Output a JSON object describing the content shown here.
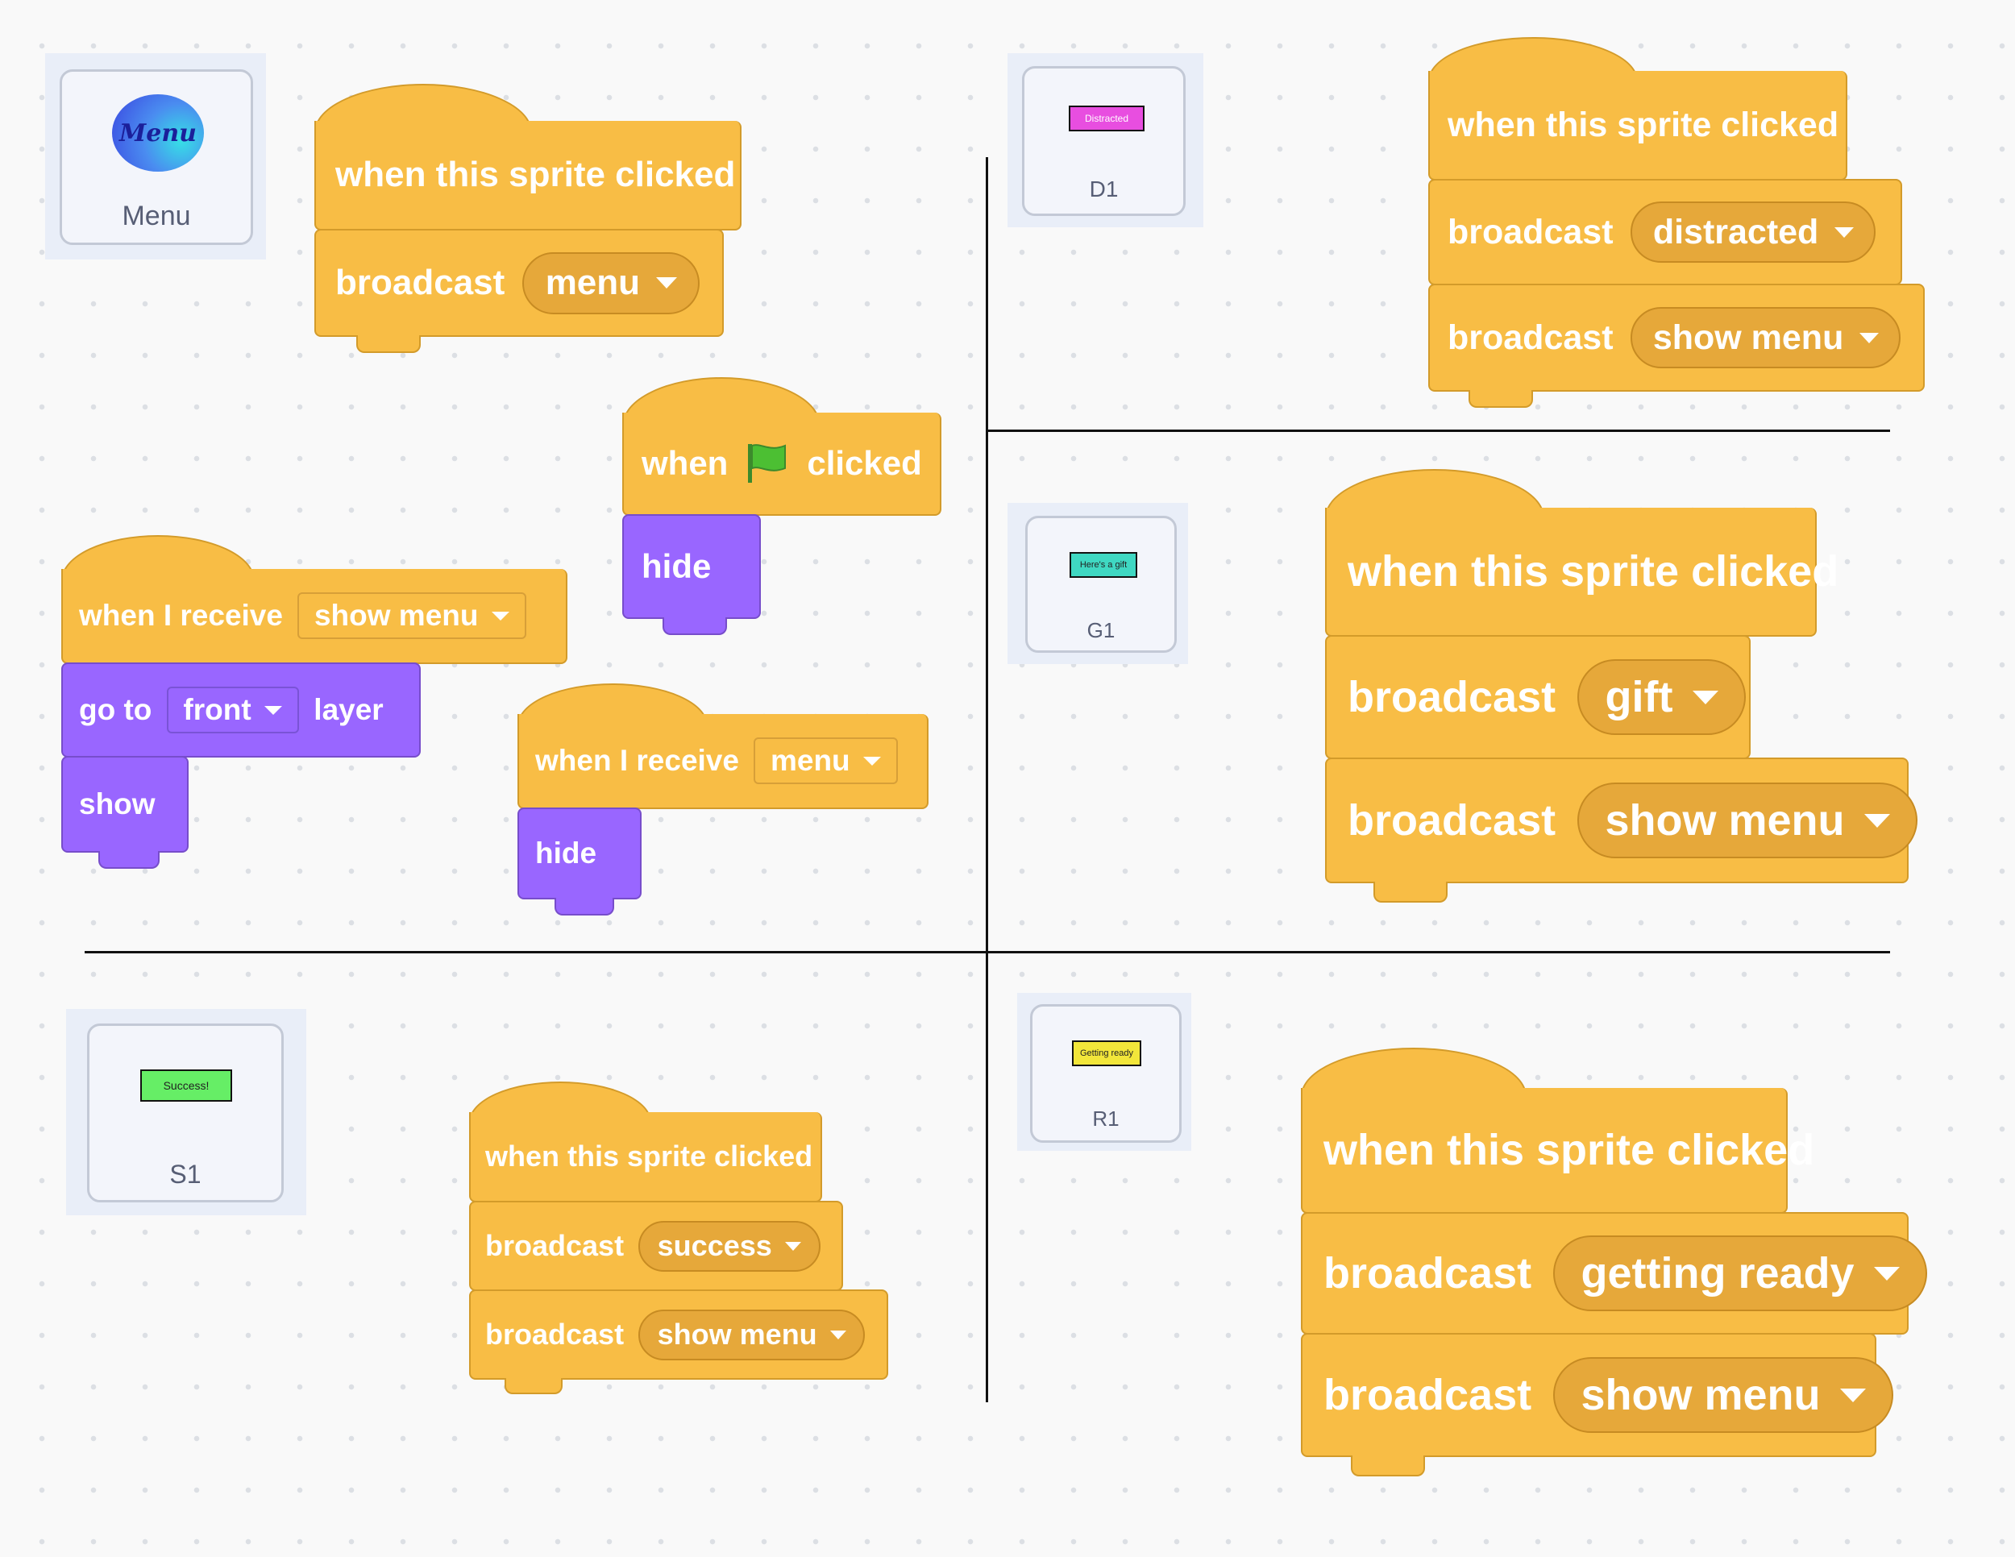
{
  "sprites": {
    "menu": {
      "name": "Menu",
      "costume_text": "Menu"
    },
    "d1": {
      "name": "D1",
      "costume_text": "Distracted",
      "color": "#e84ee0"
    },
    "g1": {
      "name": "G1",
      "costume_text": "Here's a gift",
      "color": "#3fd8c2"
    },
    "s1": {
      "name": "S1",
      "costume_text": "Success!",
      "color": "#66ee66"
    },
    "r1": {
      "name": "R1",
      "costume_text": "Getting ready",
      "color": "#f2e63a"
    }
  },
  "scripts": {
    "menu_click": {
      "hat": "when this sprite clicked",
      "broadcast": "broadcast",
      "message": "menu"
    },
    "flag": {
      "when": "when",
      "clicked": "clicked",
      "hide": "hide"
    },
    "show_menu_receive": {
      "hat": "when I receive",
      "message": "show menu",
      "goto": "go to",
      "layer_option": "front",
      "layer": "layer",
      "show": "show"
    },
    "menu_receive": {
      "hat": "when I receive",
      "message": "menu",
      "hide": "hide"
    },
    "d1_click": {
      "hat": "when this sprite clicked",
      "broadcast1": "broadcast",
      "message1": "distracted",
      "broadcast2": "broadcast",
      "message2": "show menu"
    },
    "g1_click": {
      "hat": "when this sprite clicked",
      "broadcast1": "broadcast",
      "message1": "gift",
      "broadcast2": "broadcast",
      "message2": "show menu"
    },
    "s1_click": {
      "hat": "when this sprite clicked",
      "broadcast1": "broadcast",
      "message1": "success",
      "broadcast2": "broadcast",
      "message2": "show menu"
    },
    "r1_click": {
      "hat": "when this sprite clicked",
      "broadcast1": "broadcast",
      "message1": "getting ready",
      "broadcast2": "broadcast",
      "message2": "show menu"
    }
  },
  "colors": {
    "events": "#f8bd45",
    "looks": "#9966ff",
    "divider": "#111111"
  },
  "icons": {
    "flag": "green-flag-icon",
    "dropdown": "dropdown-caret-icon"
  }
}
